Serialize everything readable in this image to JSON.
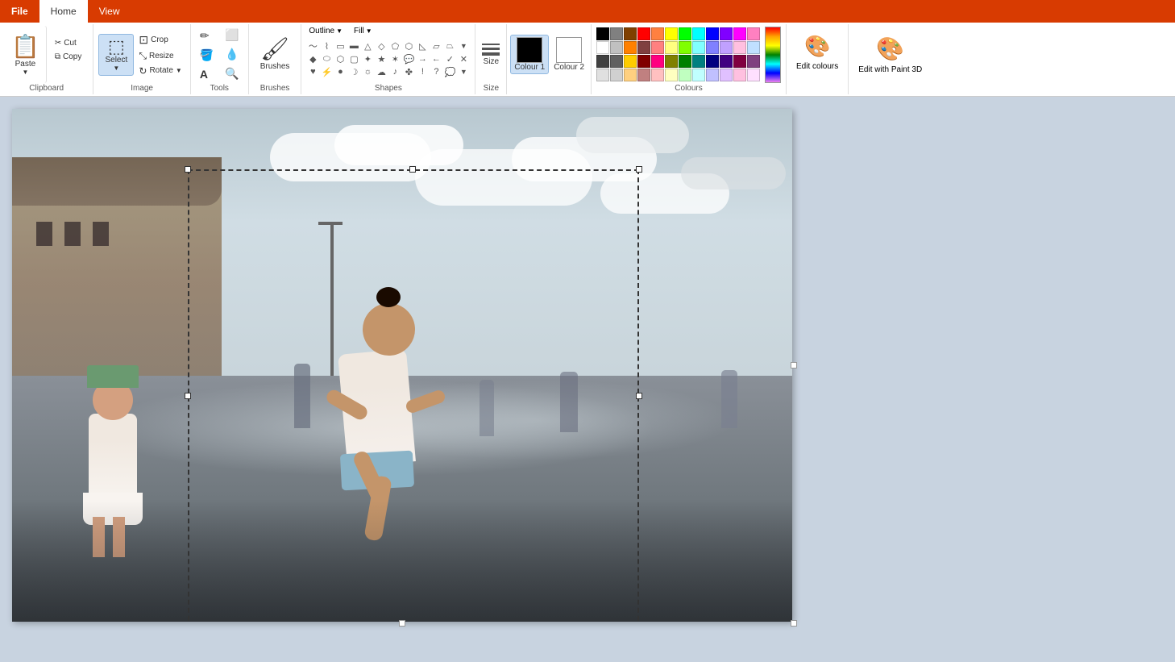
{
  "tabs": {
    "file": "File",
    "home": "Home",
    "view": "View"
  },
  "clipboard": {
    "paste_label": "Paste",
    "cut_label": "Cut",
    "copy_label": "Copy",
    "group_label": "Clipboard"
  },
  "image": {
    "crop_label": "Crop",
    "resize_label": "Resize",
    "rotate_label": "Rotate",
    "group_label": "Image"
  },
  "tools": {
    "group_label": "Tools",
    "pencil_label": "Pencil",
    "fill_label": "Fill",
    "text_label": "Text",
    "eraser_label": "Eraser",
    "color_picker_label": "Colour picker",
    "zoom_label": "Zoom"
  },
  "brushes": {
    "label": "Brushes"
  },
  "shapes": {
    "group_label": "Shapes",
    "outline_label": "Outline",
    "fill_label": "Fill"
  },
  "size": {
    "group_label": "Size",
    "label": "Size"
  },
  "colours": {
    "group_label": "Colours",
    "colour1_label": "Colour 1",
    "colour2_label": "Colour 2",
    "edit_colours_label": "Edit colours",
    "edit_paint3d_label": "Edit with Paint 3D",
    "colour1_value": "#000000",
    "colour2_value": "#ffffff",
    "palette": [
      [
        "#000000",
        "#808080",
        "#804000",
        "#ff0000",
        "#ff8040",
        "#ffff00",
        "#00ff00",
        "#00ffff",
        "#0000ff",
        "#8000ff",
        "#ff00ff",
        "#ff80ff"
      ],
      [
        "#ffffff",
        "#c0c0c0",
        "#ff8000",
        "#804040",
        "#ff8080",
        "#ffff80",
        "#80ff00",
        "#80ffff",
        "#8080ff",
        "#8000ff",
        "#ff80c0",
        "#ffc0ff"
      ],
      [
        "#404040",
        "#606060",
        "#ffc000",
        "#800000",
        "#ff0080",
        "#808000",
        "#008000",
        "#008080",
        "#000080",
        "#400080",
        "#800040",
        "#804080"
      ],
      [
        "#e0e0e0",
        "#d0d0d0",
        "#ffd080",
        "#c08080",
        "#ffc0c0",
        "#ffffc0",
        "#c0ffc0",
        "#c0ffff",
        "#c0c0ff",
        "#c0a0ff",
        "#ffc0e0",
        "#ffe0ff"
      ]
    ]
  },
  "select": {
    "label": "Select"
  }
}
